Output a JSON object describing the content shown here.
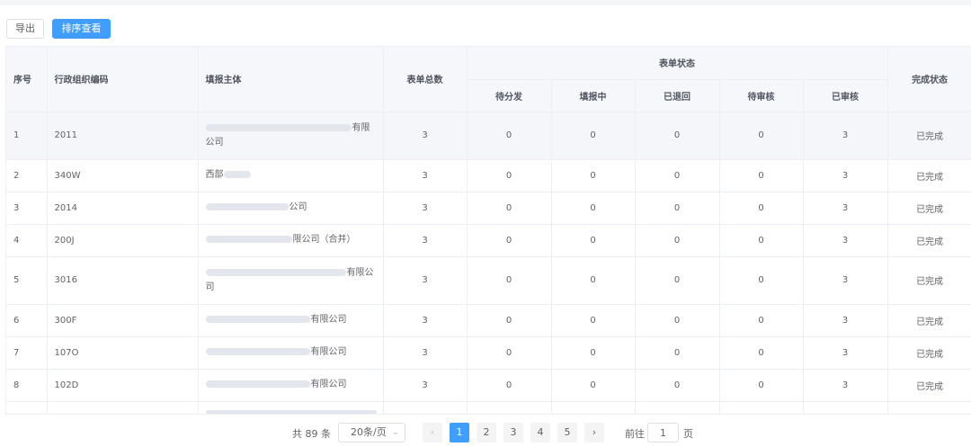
{
  "toolbar": {
    "export_label": "导出",
    "sort_label": "排序查看"
  },
  "table": {
    "headers": {
      "index": "序号",
      "org_code": "行政组织编码",
      "entity": "填报主体",
      "total": "表单总数",
      "status_group": "表单状态",
      "pending_dist": "待分发",
      "filling": "填报中",
      "returned": "已退回",
      "pending_review": "待审核",
      "reviewed": "已审核",
      "completion": "完成状态"
    },
    "rows": [
      {
        "index": "1",
        "code": "2011",
        "entity_line1": "有限",
        "entity_line2": "公司",
        "total": "3",
        "pending_dist": "0",
        "filling": "0",
        "returned": "0",
        "pending_review": "0",
        "reviewed": "3",
        "status": "已完成"
      },
      {
        "index": "2",
        "code": "340W",
        "entity_line1": "西部",
        "entity_line2": "",
        "total": "3",
        "pending_dist": "0",
        "filling": "0",
        "returned": "0",
        "pending_review": "0",
        "reviewed": "3",
        "status": "已完成"
      },
      {
        "index": "3",
        "code": "2014",
        "entity_line1": "公司",
        "entity_line2": "",
        "total": "3",
        "pending_dist": "0",
        "filling": "0",
        "returned": "0",
        "pending_review": "0",
        "reviewed": "3",
        "status": "已完成"
      },
      {
        "index": "4",
        "code": "200J",
        "entity_line1": "限公司（合并）",
        "entity_line2": "",
        "total": "3",
        "pending_dist": "0",
        "filling": "0",
        "returned": "0",
        "pending_review": "0",
        "reviewed": "3",
        "status": "已完成"
      },
      {
        "index": "5",
        "code": "3016",
        "entity_line1": "有限公",
        "entity_line2": "司",
        "total": "3",
        "pending_dist": "0",
        "filling": "0",
        "returned": "0",
        "pending_review": "0",
        "reviewed": "3",
        "status": "已完成"
      },
      {
        "index": "6",
        "code": "300F",
        "entity_line1": "有限公司",
        "entity_line2": "",
        "total": "3",
        "pending_dist": "0",
        "filling": "0",
        "returned": "0",
        "pending_review": "0",
        "reviewed": "3",
        "status": "已完成"
      },
      {
        "index": "7",
        "code": "107O",
        "entity_line1": "有限公司",
        "entity_line2": "",
        "total": "3",
        "pending_dist": "0",
        "filling": "0",
        "returned": "0",
        "pending_review": "0",
        "reviewed": "3",
        "status": "已完成"
      },
      {
        "index": "8",
        "code": "102D",
        "entity_line1": "有限公司",
        "entity_line2": "",
        "total": "3",
        "pending_dist": "0",
        "filling": "0",
        "returned": "0",
        "pending_review": "0",
        "reviewed": "3",
        "status": "已完成"
      }
    ]
  },
  "pagination": {
    "total_text": "共 89 条",
    "page_size": "20条/页",
    "pages": [
      "1",
      "2",
      "3",
      "4",
      "5"
    ],
    "current_page": "1",
    "goto_label": "前往",
    "goto_value": "1",
    "page_unit": "页"
  },
  "colors": {
    "primary": "#409eff",
    "header_bg": "#f5f7fa",
    "border": "#ebeef5"
  }
}
